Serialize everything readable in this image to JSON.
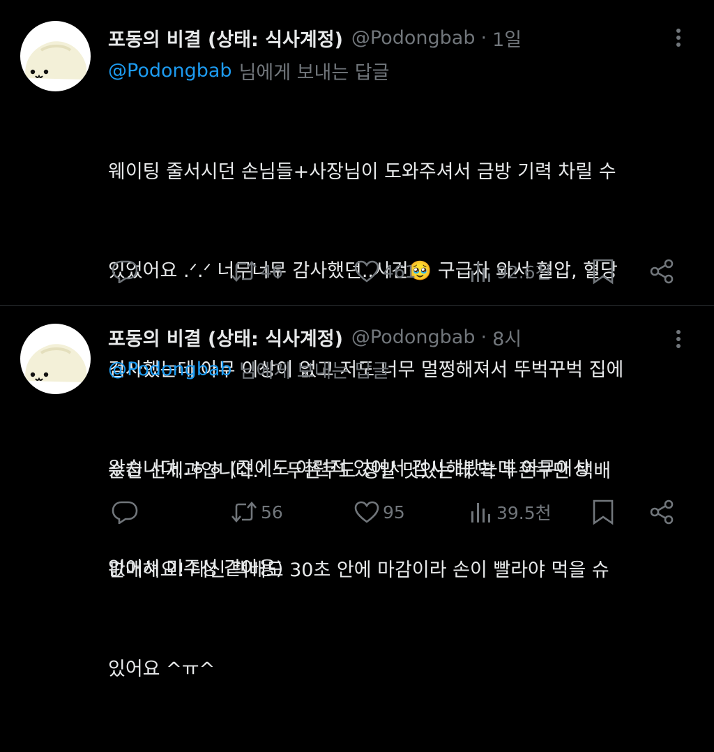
{
  "tweets": [
    {
      "author_name": "포동의 비결 (상태: 식사계정)",
      "handle": "@Podongbab",
      "separator": "·",
      "time": "1일",
      "reply_mention": "@Podongbab",
      "reply_rest": "님에게 보내는 답글",
      "lines": [
        "웨이팅 줄서시던 손님들+사장님이 도와주셔서 금방 기력 차릴 수",
        "있었어요 .ᐟ.ᐟ 너무너무 감사했던..사건🥹 구급차 와서 혈압, 혈당",
        "검사했는데 아무 이상이 없고 저도 너무 멀쩡해져서 뚜벅꾸벅 집에",
        "왔습니다..ㅎㅎ (전에도 이런적 있어서 검사해봤는데 아무이상",
        "없어서 미주성 같아용)"
      ],
      "retweets": "46",
      "likes": "461",
      "views": "92.6천"
    },
    {
      "author_name": "포동의 비결 (상태: 식사계정)",
      "handle": "@Podongbab",
      "separator": "·",
      "time": "8시",
      "reply_mention": "@Podongbab",
      "reply_rest": "님에게 보내는 답글",
      "lines": [
        "순천 선제과입니다.ᐟ.ᐟ 두쫀쿠도 정말 맛있는데 딱 두쫀쿠만 택배",
        "판매해요! 대신 택배도 30초 안에 마감이라 손이 빨라야 먹을 슈",
        "있어요 ^ㅠ^"
      ],
      "retweets": "56",
      "likes": "95",
      "views": "39.5천"
    }
  ],
  "colors": {
    "background": "#000000",
    "text": "#e7e9ea",
    "muted": "#71767b",
    "accent": "#1d9bf0",
    "divider": "#2f3336"
  },
  "icons": [
    "more-icon",
    "reply-icon",
    "retweet-icon",
    "like-icon",
    "views-icon",
    "bookmark-icon",
    "share-icon"
  ]
}
